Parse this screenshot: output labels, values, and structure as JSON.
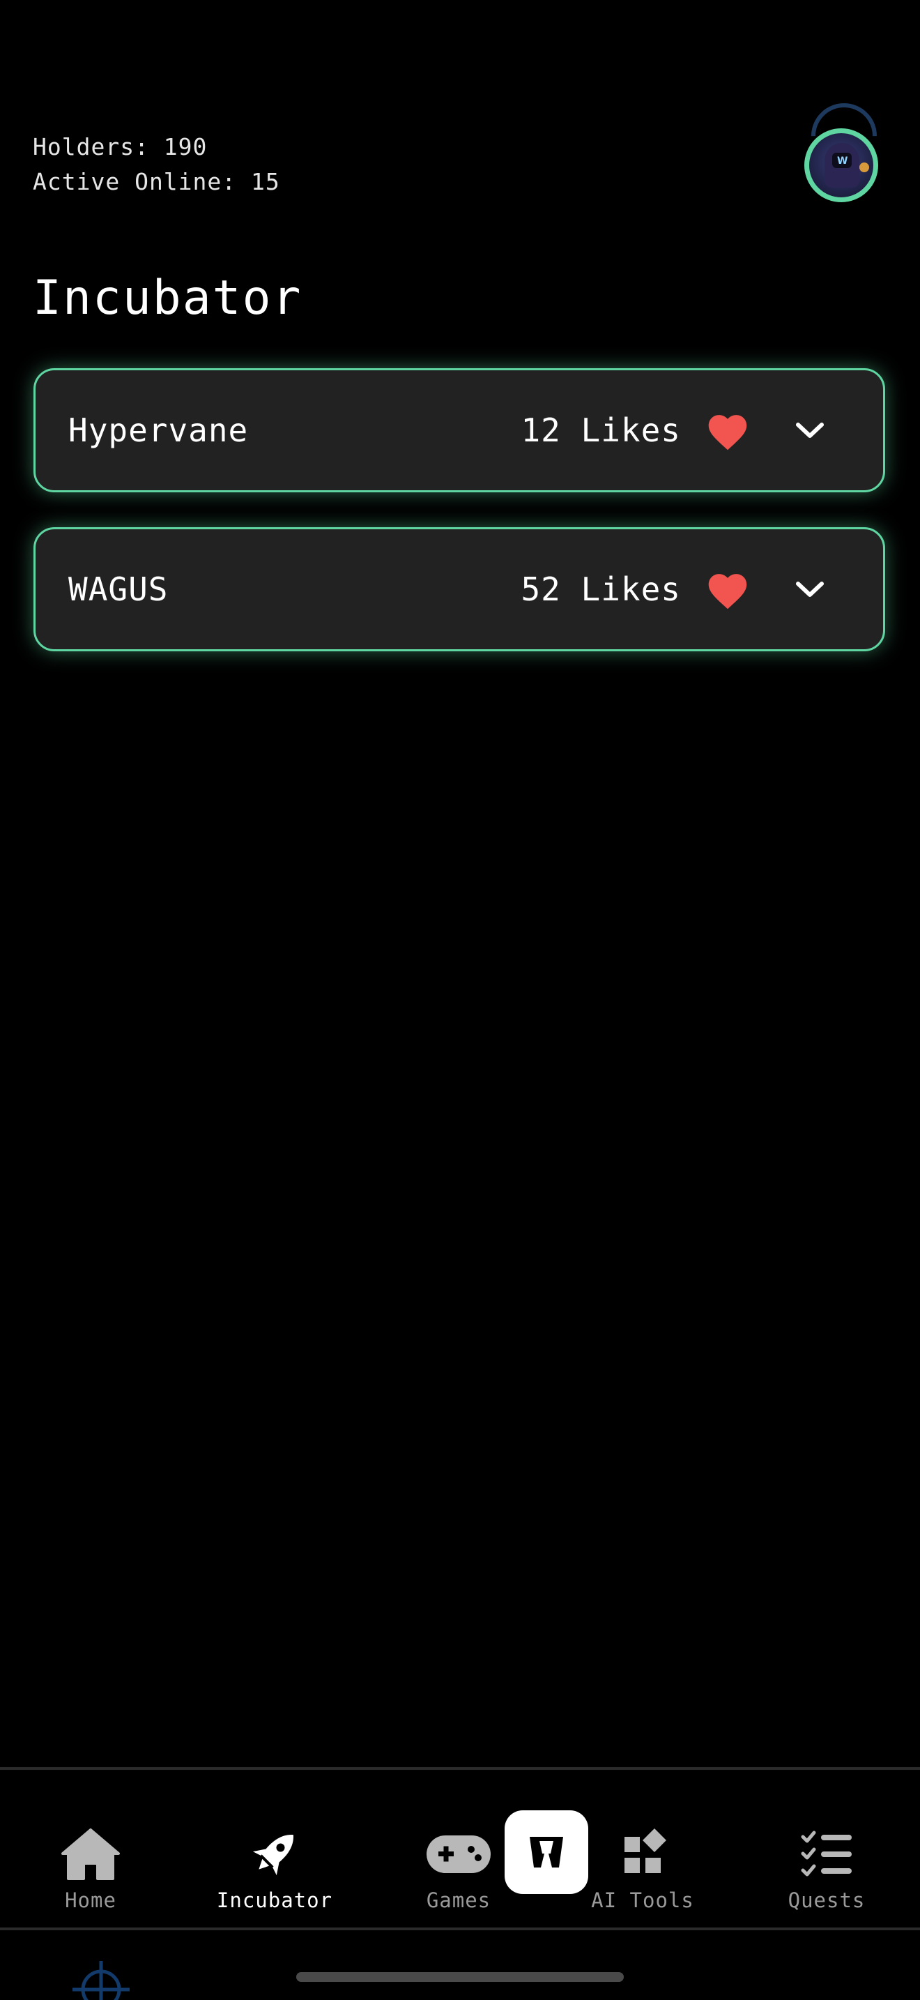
{
  "header": {
    "holders": "Holders: 190",
    "active_online": "Active Online: 15"
  },
  "page": {
    "title": "Incubator"
  },
  "projects": [
    {
      "name": "Hypervane",
      "likes": "12 Likes"
    },
    {
      "name": "WAGUS",
      "likes": "52 Likes"
    }
  ],
  "nav": {
    "items": [
      {
        "label": "Home",
        "icon": "home-icon"
      },
      {
        "label": "Incubator",
        "icon": "rocket-icon",
        "active": true
      },
      {
        "label": "Games",
        "icon": "gamepad-icon"
      },
      {
        "label": "AI Tools",
        "icon": "widgets-icon"
      },
      {
        "label": "Quests",
        "icon": "checklist-icon"
      }
    ],
    "center_icon": "wagus-logo-icon"
  },
  "colors": {
    "background": "#000000",
    "card_background": "#222222",
    "accent": "#5fd6a2",
    "heart": "#f2544f",
    "inactive_label": "#9a9a9a"
  }
}
